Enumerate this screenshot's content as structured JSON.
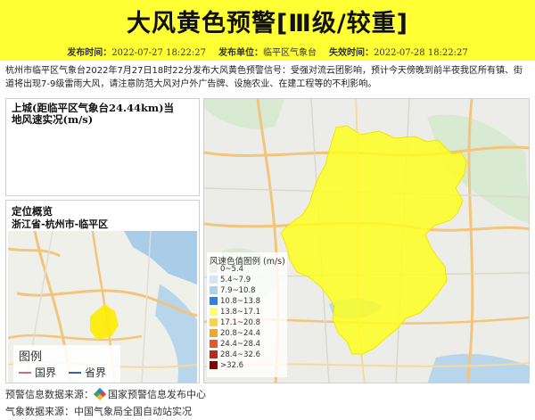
{
  "header": {
    "title": "大风黄色预警[Ⅲ级/较重]",
    "issue_time_label": "发布时间：",
    "issue_time": "2022-07-27 18:22:27",
    "issuer_label": "发布单位：",
    "issuer": "临平区气象台",
    "expire_label": "失效时间：",
    "expire_time": "2022-07-28 18:22:27",
    "bg_color": "#ffff33"
  },
  "description": "杭州市临平区气象台2022年7月27日18时22分发布大风黄色预警信号：受强对流云团影响，预计今天傍晚到前半夜我区所有镇、街道将出现7-9级雷雨大风，请注意防范大风对户外广告牌、设施农业、在建工程等的不利影响。",
  "station_panel": {
    "title": "上城(距临平区气象台24.44km)当地风速实况(m/s)"
  },
  "overview_panel": {
    "title": "定位概览",
    "location": "浙江省-杭州市-临平区",
    "legend": {
      "title": "图例",
      "items": [
        {
          "label": "国界",
          "color": "#c2707a"
        },
        {
          "label": "省界",
          "color": "#3561b5"
        }
      ]
    }
  },
  "wind_legend": {
    "title": "风速色值图例 (m/s)",
    "items": [
      {
        "label": "0~5.4",
        "color": "#f0f0f0"
      },
      {
        "label": "5.4~7.9",
        "color": "#cfe8f6"
      },
      {
        "label": "7.9~10.8",
        "color": "#a9d4f0"
      },
      {
        "label": "10.8~13.8",
        "color": "#2b83e6"
      },
      {
        "label": "13.8~17.1",
        "color": "#ffff66"
      },
      {
        "label": "17.1~20.8",
        "color": "#ffd23f"
      },
      {
        "label": "20.8~24.4",
        "color": "#f5a623"
      },
      {
        "label": "24.4~28.4",
        "color": "#e8562a"
      },
      {
        "label": "28.4~32.6",
        "color": "#c0281e"
      },
      {
        "label": ">32.6",
        "color": "#8b0000"
      }
    ]
  },
  "footer": {
    "warning_source_label": "预警信息数据来源：",
    "warning_source": "国家预警信息发布中心",
    "weather_source_label": "气象数据来源：",
    "weather_source": "中国气象局全国自动站实况"
  }
}
